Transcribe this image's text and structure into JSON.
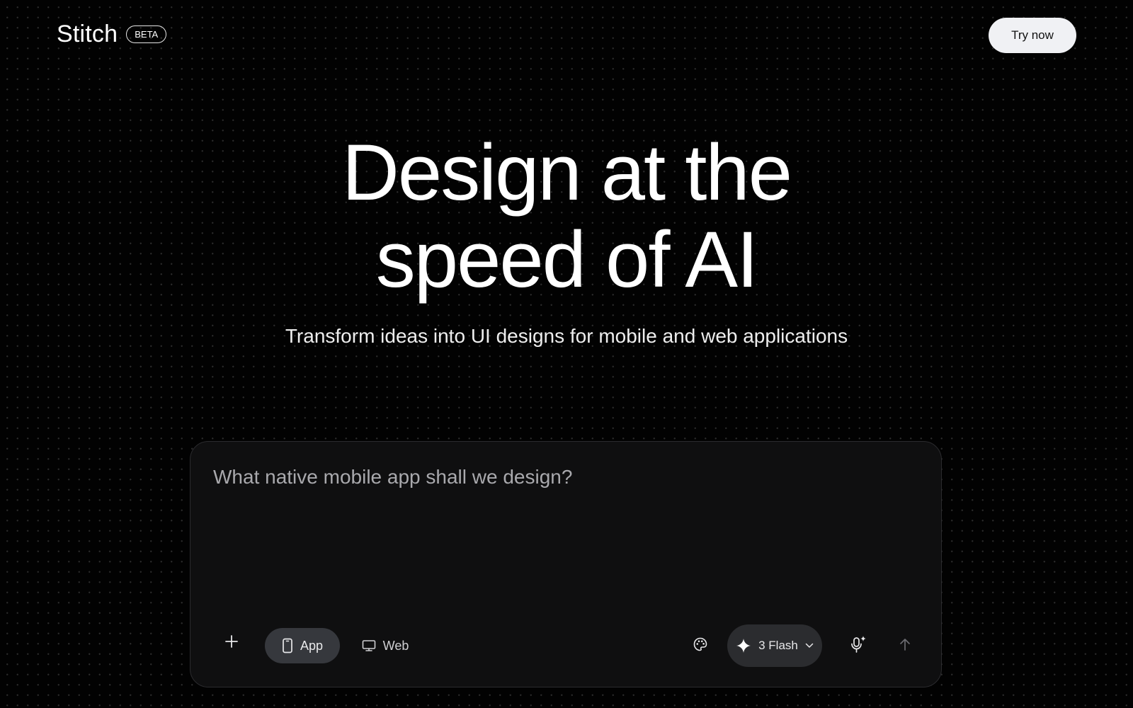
{
  "header": {
    "brand_name": "Stitch",
    "badge": "BETA",
    "cta_label": "Try now"
  },
  "hero": {
    "title_line1": "Design at the",
    "title_line2": "speed of AI",
    "subtitle": "Transform ideas into UI designs for mobile and web applications"
  },
  "composer": {
    "placeholder": "What native mobile app shall we design?",
    "value": "",
    "toggle": {
      "selected": "App",
      "options": [
        {
          "label": "App",
          "icon": "smartphone-icon"
        },
        {
          "label": "Web",
          "icon": "monitor-icon"
        }
      ]
    },
    "model_label": "3 Flash",
    "icons": {
      "add": "plus-icon",
      "theme": "palette-icon",
      "model": "sparkle-icon",
      "mic": "mic-sparkle-icon",
      "send": "arrow-up-icon"
    }
  },
  "colors": {
    "background": "#020202",
    "composer_bg": "#0f0f10",
    "cta_bg": "#f0f1f4",
    "toggle_selected_bg": "#36383d",
    "model_bg": "#2b2c2f"
  }
}
